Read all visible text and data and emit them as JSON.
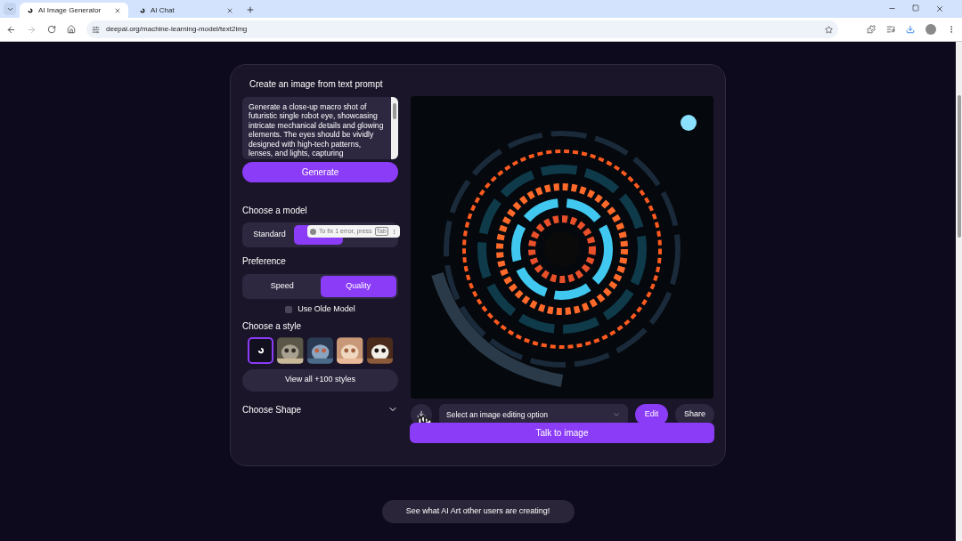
{
  "browser": {
    "tabs": [
      {
        "title": "AI Image Generator",
        "selected": true
      },
      {
        "title": "AI Chat",
        "selected": false
      }
    ],
    "url": "deepai.org/machine-learning-model/text2img"
  },
  "panel": {
    "heading": "Create an image from text prompt",
    "prompt": "Generate a close-up macro shot of futuristic single robot eye, showcasing intricate mechanical details and glowing elements. The eyes should be vividly designed with high-tech patterns, lenses, and lights, capturing",
    "generate_button": "Generate",
    "model_label": "Choose a model",
    "models": [
      {
        "label": "Standard",
        "selected": false
      },
      {
        "selected": true
      }
    ],
    "tooltip": {
      "text": "To fix 1 error, press",
      "key": "Tab"
    },
    "preference_label": "Preference",
    "preferences": [
      {
        "label": "Speed",
        "selected": false
      },
      {
        "label": "Quality",
        "selected": true
      }
    ],
    "olde_model": {
      "label": "Use Olde Model",
      "checked": false
    },
    "style_label": "Choose a style",
    "styles": [
      {
        "kind": "logo",
        "selected": true
      },
      {
        "kind": "picture",
        "selected": false
      },
      {
        "kind": "picture",
        "selected": false
      },
      {
        "kind": "picture",
        "selected": false
      },
      {
        "kind": "picture",
        "selected": false
      }
    ],
    "view_all_button": "View all +100 styles",
    "shape_label": "Choose Shape",
    "edit_select_placeholder": "Select an image editing option",
    "edit_button": "Edit",
    "share_button": "Share",
    "talk_button": "Talk to image"
  },
  "gallery_button": "See what AI Art other users are creating!"
}
